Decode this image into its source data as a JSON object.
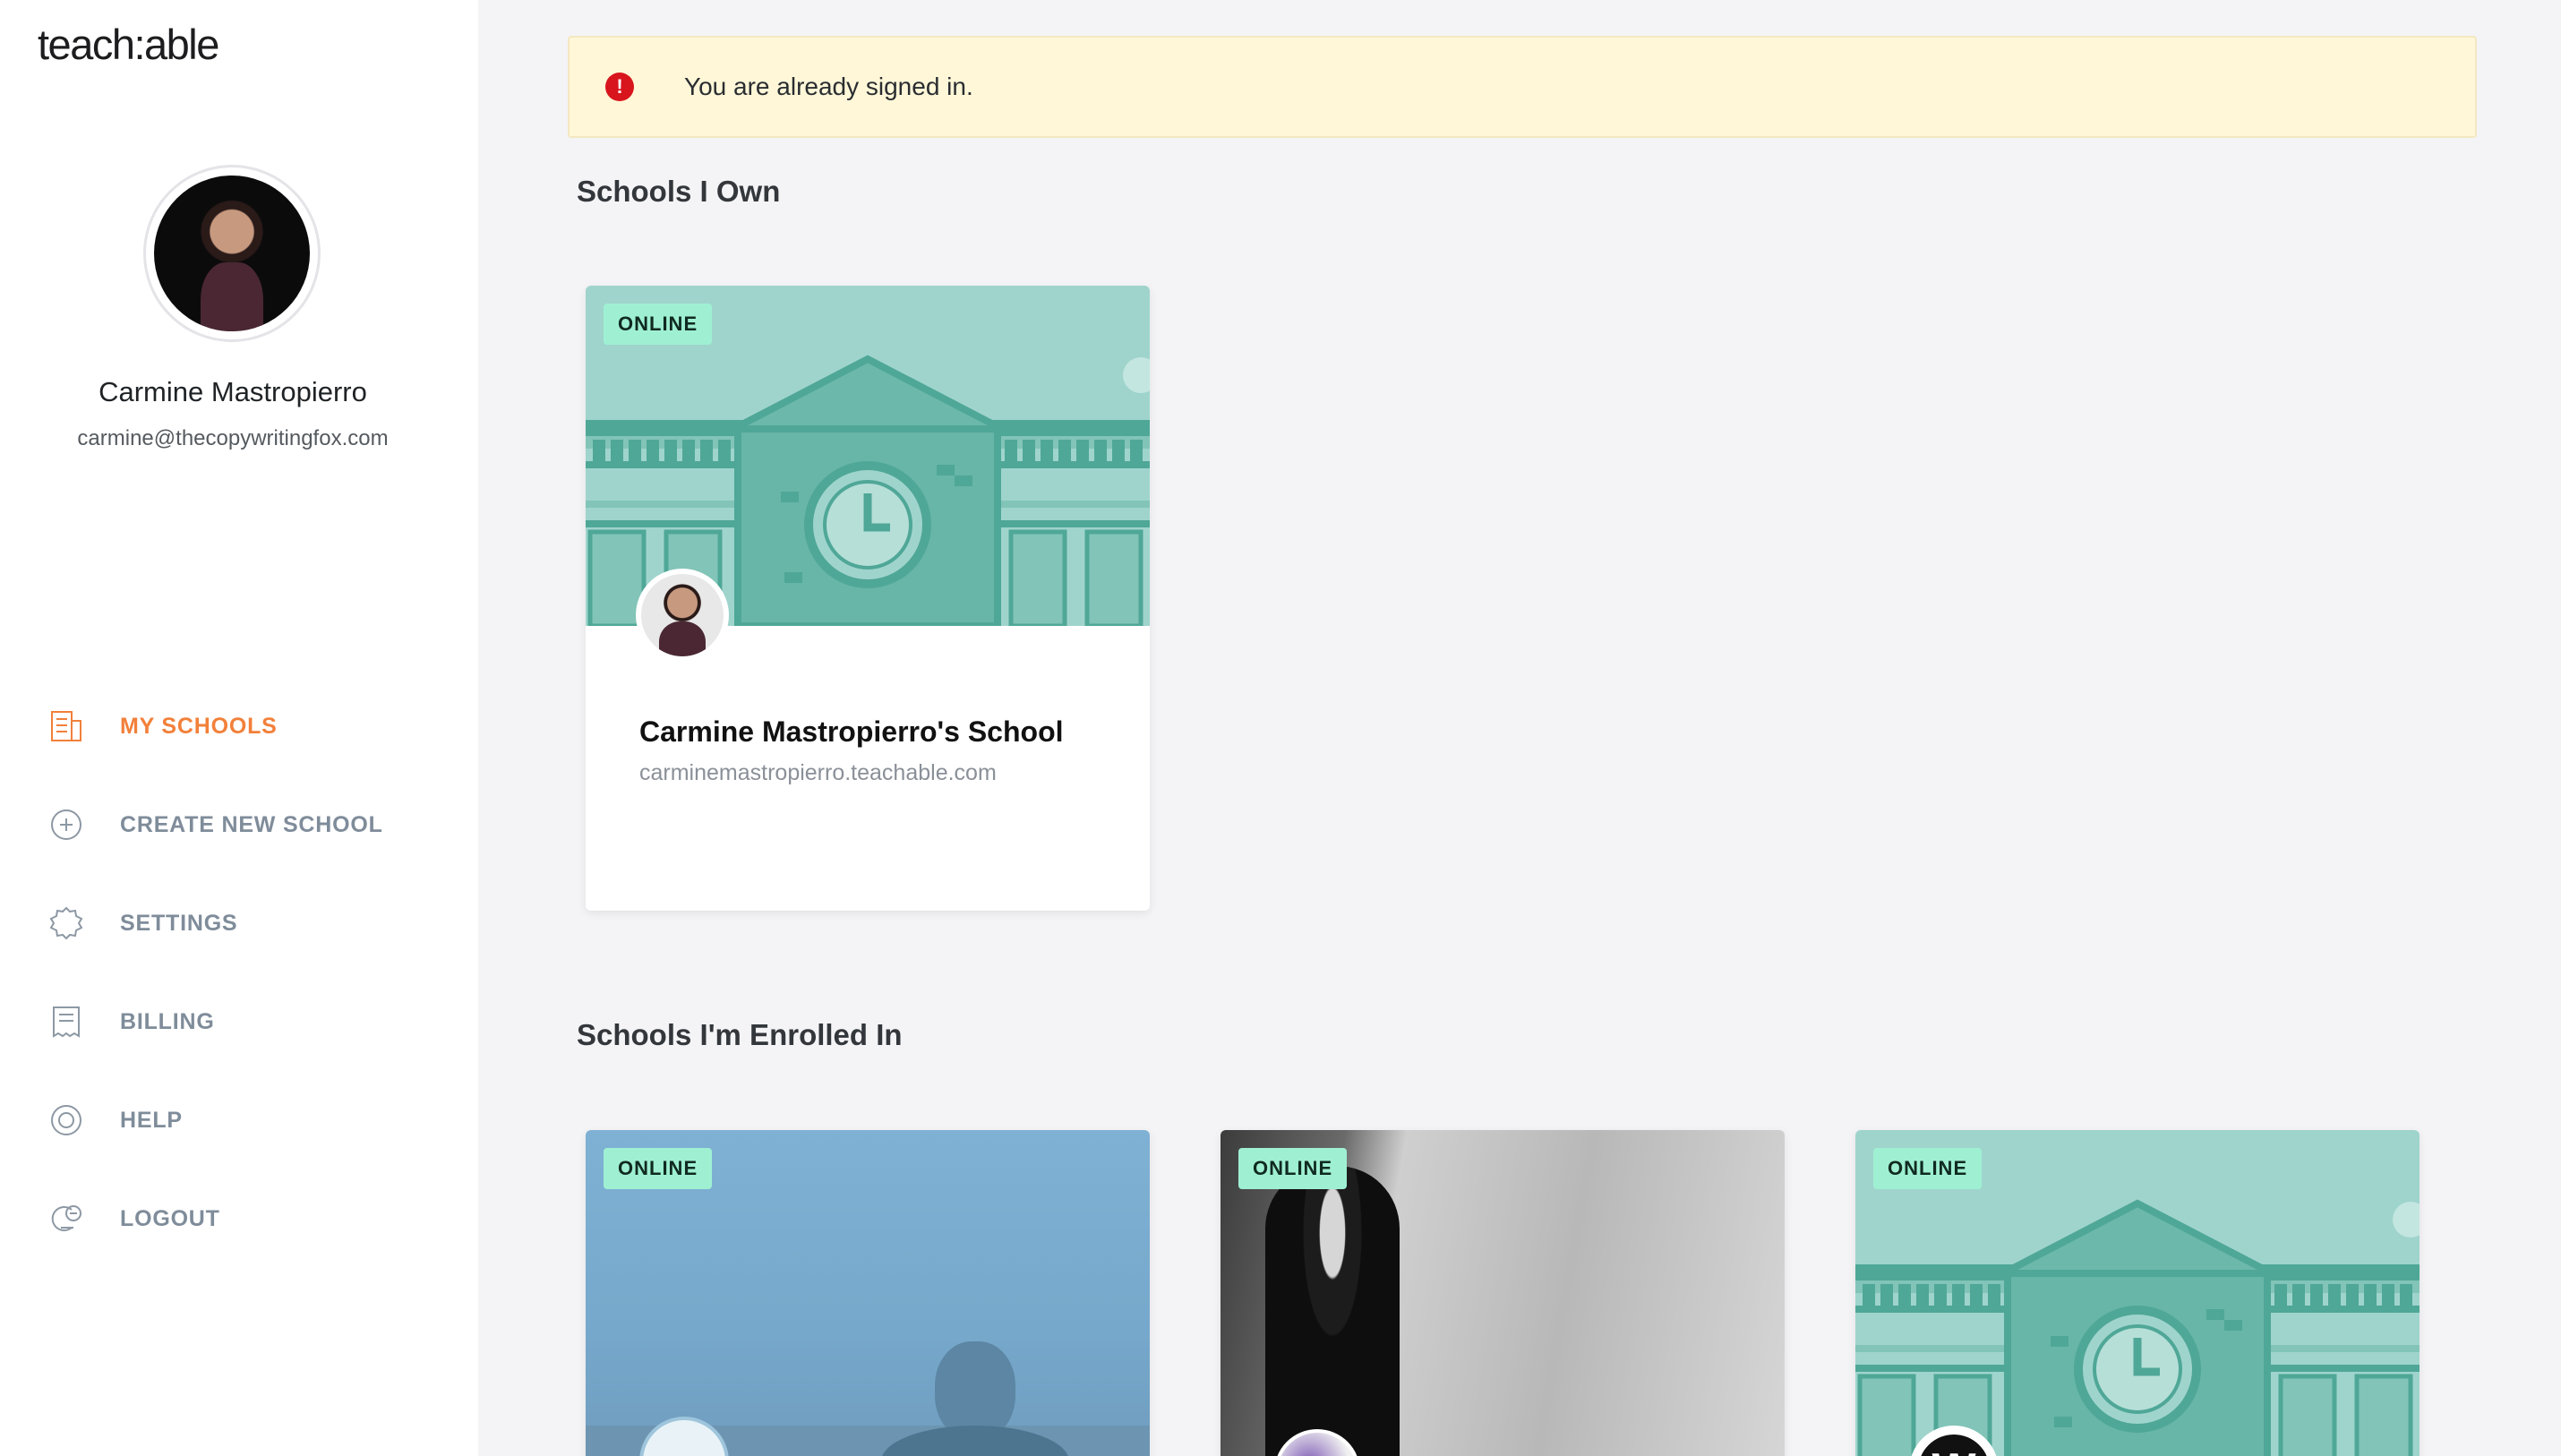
{
  "brand": {
    "logo_text": "teach:able",
    "accent": "#f2803a"
  },
  "profile": {
    "name": "Carmine Mastropierro",
    "email": "carmine@thecopywritingfox.com"
  },
  "nav": {
    "items": [
      {
        "label": "MY SCHOOLS",
        "icon": "school-building-icon",
        "active": true
      },
      {
        "label": "CREATE NEW SCHOOL",
        "icon": "plus-circle-icon",
        "active": false
      },
      {
        "label": "SETTINGS",
        "icon": "gear-icon",
        "active": false
      },
      {
        "label": "BILLING",
        "icon": "receipt-icon",
        "active": false
      },
      {
        "label": "HELP",
        "icon": "lifebuoy-icon",
        "active": false
      },
      {
        "label": "LOGOUT",
        "icon": "logout-icon",
        "active": false
      }
    ]
  },
  "alert": {
    "text": "You are already signed in.",
    "icon": "error-icon",
    "icon_glyph": "!"
  },
  "owned": {
    "title": "Schools I Own",
    "schools": [
      {
        "status": "ONLINE",
        "name": "Carmine Mastropierro's School",
        "url": "carminemastropierro.teachable.com"
      }
    ]
  },
  "enrolled": {
    "title": "Schools I'm Enrolled In",
    "schools": [
      {
        "status": "ONLINE"
      },
      {
        "status": "ONLINE"
      },
      {
        "status": "ONLINE"
      }
    ]
  }
}
